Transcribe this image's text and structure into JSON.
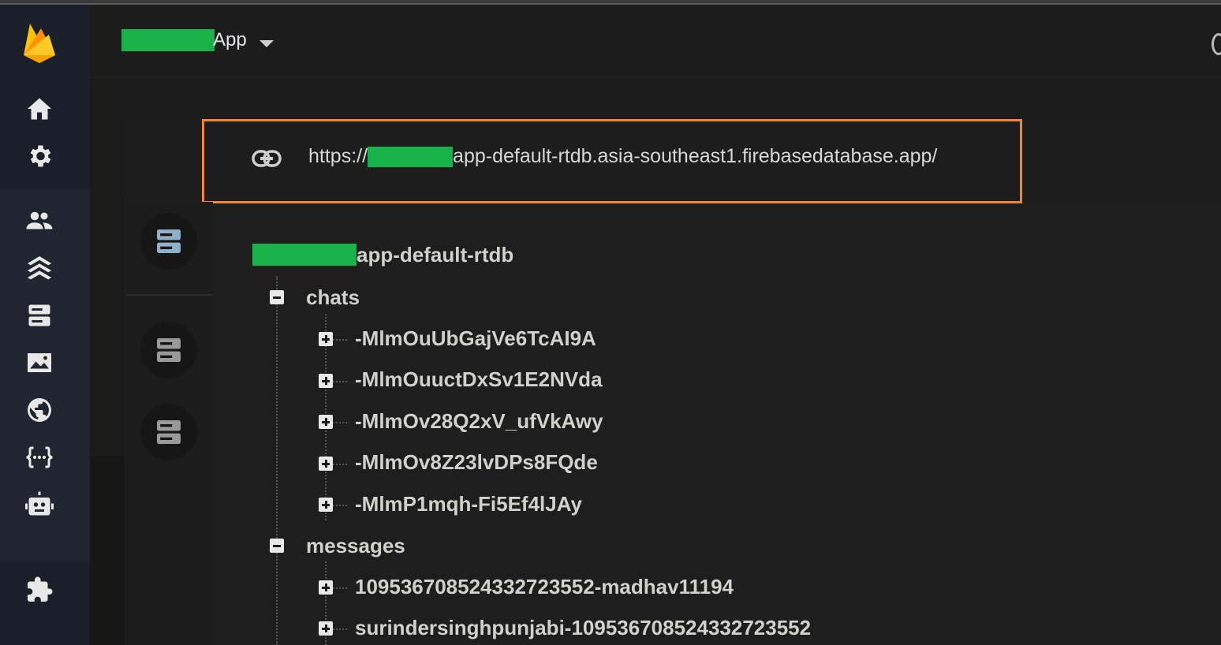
{
  "header": {
    "project_name": "App"
  },
  "url": {
    "prefix": "https://",
    "suffix": "app-default-rtdb.asia-southeast1.firebasedatabase.app/"
  },
  "tree": {
    "root_suffix": "app-default-rtdb",
    "groups": [
      {
        "label": "chats",
        "children": [
          "-MlmOuUbGajVe6TcAI9A",
          "-MlmOuuctDxSv1E2NVda",
          "-MlmOv28Q2xV_ufVkAwy",
          "-MlmOv8Z23lvDPs8FQde",
          "-MlmP1mqh-Fi5Ef4lJAy"
        ]
      },
      {
        "label": "messages",
        "children": [
          "109536708524332723552-madhav11194",
          "surindersinghpunjabi-109536708524332723552"
        ]
      }
    ]
  },
  "nav_icons": [
    "home-icon",
    "settings-icon",
    "users-icon",
    "hosting-icon",
    "database-icon",
    "storage-icon",
    "web-icon",
    "functions-icon",
    "ml-icon",
    "extensions-icon"
  ],
  "colors": {
    "highlight": "#f38634",
    "redaction": "#17b34a",
    "firebase_orange": "#ffa000"
  }
}
